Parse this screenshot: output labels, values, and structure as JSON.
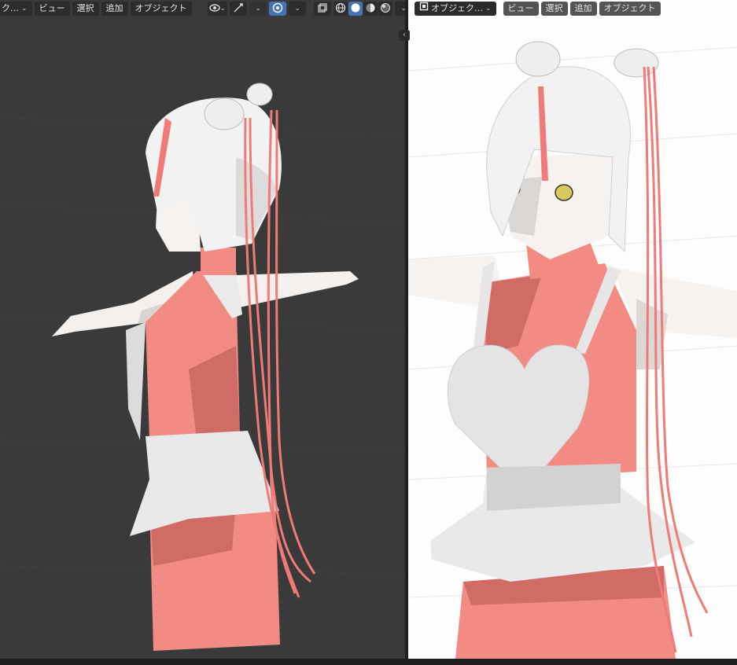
{
  "left_viewport": {
    "mode_selector": {
      "label": "ク…"
    },
    "menu": {
      "view": "ビュー",
      "select": "選択",
      "add": "追加",
      "object": "オブジェクト"
    },
    "icons": [
      "eye-icon",
      "gizmo-icon",
      "overlay-icon",
      "xray-icon",
      "wireframe-shading-icon",
      "solid-shading-icon",
      "material-shading-icon",
      "rendered-shading-icon"
    ],
    "shading_active": "solid"
  },
  "right_viewport": {
    "mode_selector": {
      "label": "オブジェク…"
    },
    "menu": {
      "view": "ビュー",
      "select": "選択",
      "add": "追加",
      "object": "オブジェクト"
    }
  },
  "colors": {
    "accent": "#4772b3",
    "dress": "#f28b84",
    "dress_shadow": "#cf6c66",
    "white_cloth": "#e9e9e9",
    "hair": "#f2f2f2",
    "ribbon": "#f07a76"
  }
}
